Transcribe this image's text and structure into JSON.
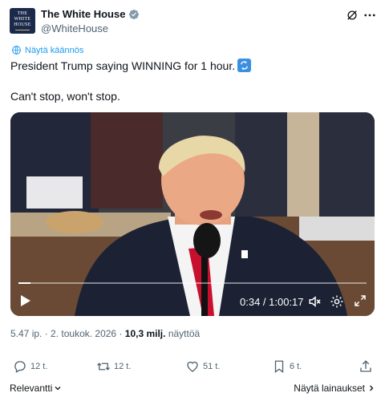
{
  "header": {
    "display_name": "The White House",
    "handle": "@WhiteHouse",
    "avatar_text_line1": "THE",
    "avatar_text_line2": "WHITE",
    "avatar_text_line3": "HOUSE"
  },
  "translate_link": "Näytä käännös",
  "tweet": {
    "line1": "President Trump saying WINNING for 1 hour.",
    "line2": "Can't stop, won't stop."
  },
  "video": {
    "time": "0:34 / 1:00:17",
    "progress": 0.035
  },
  "meta": {
    "time": "5.47 ip.",
    "separator1": " · ",
    "date": "2. toukok. 2026",
    "separator2": " · ",
    "views_count": "10,3 milj.",
    "views_label": " näyttöä"
  },
  "actions": {
    "replies": "12 t.",
    "reposts": "12 t.",
    "likes": "51 t.",
    "bookmarks": "6 t."
  },
  "footer": {
    "sort_label": "Relevantti",
    "quotes_label": "Näytä lainaukset"
  },
  "colors": {
    "accent": "#1d9bf0",
    "text": "#0f1419",
    "muted": "#536471"
  },
  "icons": [
    "verified-badge-icon",
    "grok-icon",
    "more-icon",
    "translate-icon",
    "repeat-emoji-icon",
    "play-icon",
    "volume-icon",
    "settings-icon",
    "fullscreen-icon",
    "reply-icon",
    "repost-icon",
    "like-icon",
    "bookmark-icon",
    "share-icon",
    "chevron-down-icon",
    "chevron-right-icon"
  ]
}
